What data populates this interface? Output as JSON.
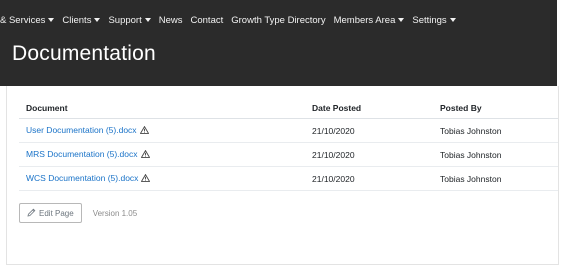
{
  "nav": {
    "items": [
      {
        "label": "& Services",
        "dropdown": true
      },
      {
        "label": "Clients",
        "dropdown": true
      },
      {
        "label": "Support",
        "dropdown": true
      },
      {
        "label": "News",
        "dropdown": false
      },
      {
        "label": "Contact",
        "dropdown": false
      },
      {
        "label": "Growth Type Directory",
        "dropdown": false
      },
      {
        "label": "Members Area",
        "dropdown": true
      },
      {
        "label": "Settings",
        "dropdown": true
      }
    ]
  },
  "page": {
    "title": "Documentation"
  },
  "table": {
    "headers": {
      "document": "Document",
      "date_posted": "Date Posted",
      "posted_by": "Posted By"
    },
    "rows": [
      {
        "document": "User Documentation (5).docx",
        "date_posted": "21/10/2020",
        "posted_by": "Tobias Johnston",
        "icon": "warning-triangle-icon"
      },
      {
        "document": "MRS Documentation (5).docx",
        "date_posted": "21/10/2020",
        "posted_by": "Tobias Johnston",
        "icon": "warning-triangle-icon"
      },
      {
        "document": "WCS Documentation (5).docx",
        "date_posted": "21/10/2020",
        "posted_by": "Tobias Johnston",
        "icon": "warning-triangle-icon"
      }
    ]
  },
  "footer": {
    "edit_label": "Edit Page",
    "edit_icon": "pencil-icon",
    "version": "Version 1.05"
  },
  "colors": {
    "header_bg": "#2b2b2b",
    "link": "#1a73c8"
  }
}
